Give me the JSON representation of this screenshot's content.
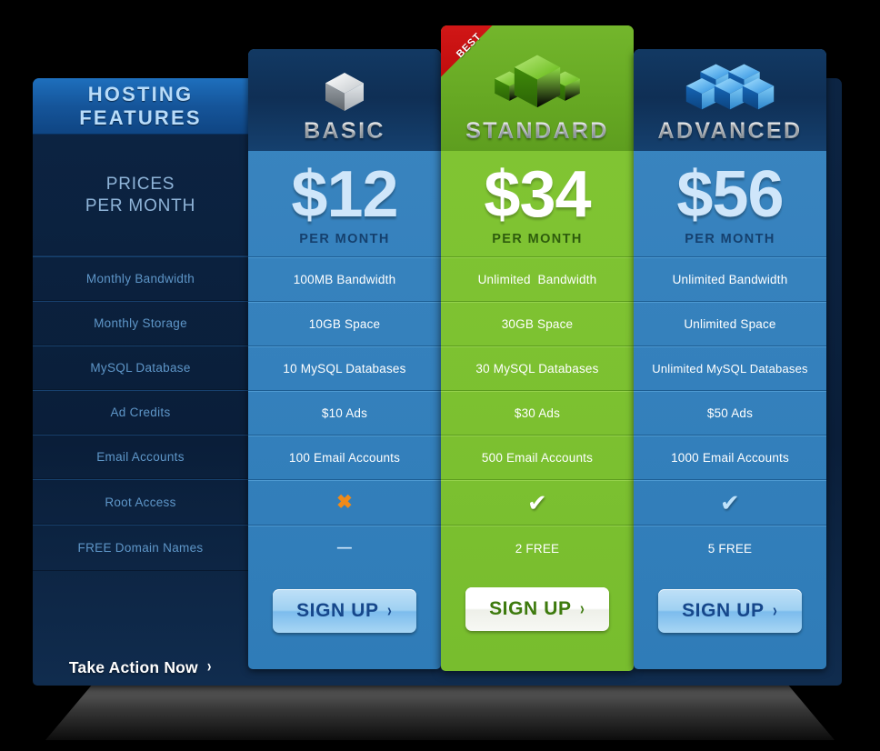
{
  "features_column": {
    "header": {
      "line1": "HOSTING",
      "line2": "FEATURES"
    },
    "prices_label": {
      "line1": "PRICES",
      "line2": "PER MONTH"
    },
    "rows": [
      {
        "label": "Monthly Bandwidth"
      },
      {
        "label": "Monthly Storage"
      },
      {
        "label": "MySQL Database"
      },
      {
        "label": "Ad Credits"
      },
      {
        "label": "Email Accounts"
      },
      {
        "label": "Root Access"
      },
      {
        "label": "FREE Domain Names"
      }
    ],
    "action_label": "Take Action Now",
    "action_arrow": "›"
  },
  "ribbon": {
    "label": "BEST",
    "color": "#d11414"
  },
  "plans": [
    {
      "id": "basic",
      "name": "BASIC",
      "icon": "single-cube-icon",
      "icon_color": "#c9cdd1",
      "price": "$12",
      "per_month": "PER MONTH",
      "accent": "#2f7cb8",
      "header_bg": "#0f2f55",
      "values": [
        "100MB Bandwidth",
        "10GB Space",
        "10 MySQL Databases",
        "$10 Ads",
        "100 Email Accounts"
      ],
      "root_access": {
        "type": "cross",
        "glyph": "✖",
        "color": "#f08a18"
      },
      "free_domains": {
        "type": "dash",
        "glyph": "—",
        "text": "—"
      },
      "signup_label": "SIGN UP",
      "signup_arrow": "›"
    },
    {
      "id": "standard",
      "name": "STANDARD",
      "icon": "triple-cube-icon",
      "icon_color": "#5fbf1e",
      "price": "$34",
      "per_month": "PER MONTH",
      "accent": "#78bd2e",
      "header_bg": "#66a823",
      "values": [
        "Unlimited  Bandwidth",
        "30GB Space",
        "30 MySQL Databases",
        "$30 Ads",
        "500 Email Accounts"
      ],
      "root_access": {
        "type": "check",
        "glyph": "✔",
        "color": "#ffffff"
      },
      "free_domains": {
        "type": "text",
        "text": "2 FREE"
      },
      "signup_label": "SIGN UP",
      "signup_arrow": "›"
    },
    {
      "id": "advanced",
      "name": "ADVANCED",
      "icon": "multi-cube-icon",
      "icon_color": "#2b9ff0",
      "price": "$56",
      "per_month": "PER MONTH",
      "accent": "#2f7cb8",
      "header_bg": "#0f2f55",
      "values": [
        "Unlimited Bandwidth",
        "Unlimited Space",
        "Unlimited MySQL Databases",
        "$50 Ads",
        "1000 Email Accounts"
      ],
      "root_access": {
        "type": "check",
        "glyph": "✔",
        "color": "#bfe2fb"
      },
      "free_domains": {
        "type": "text",
        "text": "5 FREE"
      },
      "signup_label": "SIGN UP",
      "signup_arrow": "›"
    }
  ]
}
